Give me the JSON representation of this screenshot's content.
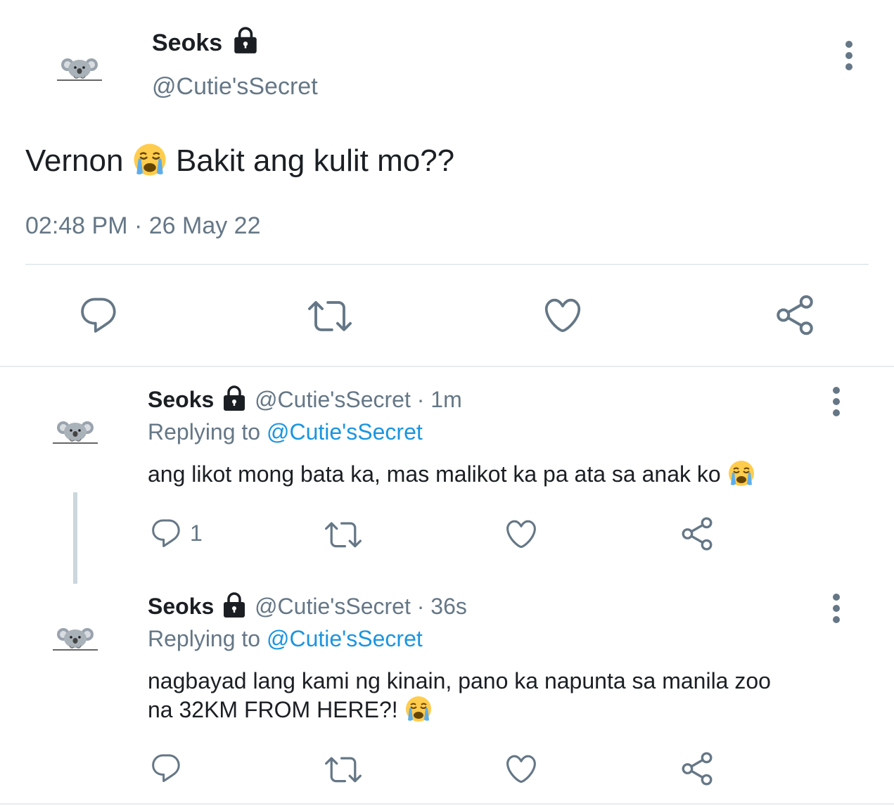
{
  "main_tweet": {
    "display_name": "Seoks",
    "handle": "@Cutie'sSecret",
    "text_before_emoji": "Vernon",
    "text_after_emoji": "Bakit ang kulit mo??",
    "timestamp": "02:48 PM · 26 May 22",
    "icons": [
      "avatar-koala",
      "lock-icon",
      "more-icon",
      "reply-icon",
      "retweet-icon",
      "like-icon",
      "share-icon",
      "crying-face-emoji"
    ]
  },
  "replies": [
    {
      "display_name": "Seoks",
      "handle": "@Cutie'sSecret",
      "time": "· 1m",
      "replying_prefix": "Replying to",
      "replying_handle": "@Cutie'sSecret",
      "text": "ang likot mong bata ka, mas malikot ka pa ata sa anak ko",
      "reply_count": "1"
    },
    {
      "display_name": "Seoks",
      "handle": "@Cutie'sSecret",
      "time": "· 36s",
      "replying_prefix": "Replying to",
      "replying_handle": "@Cutie'sSecret",
      "text_line1": "nagbayad lang kami ng kinain, pano ka napunta sa manila zoo",
      "text_line2": "na 32KM FROM HERE?!",
      "reply_count": ""
    }
  ],
  "colors": {
    "text": "#1b1f23",
    "muted": "#657786",
    "link": "#1b95e0",
    "divider": "#e6ecf0"
  }
}
